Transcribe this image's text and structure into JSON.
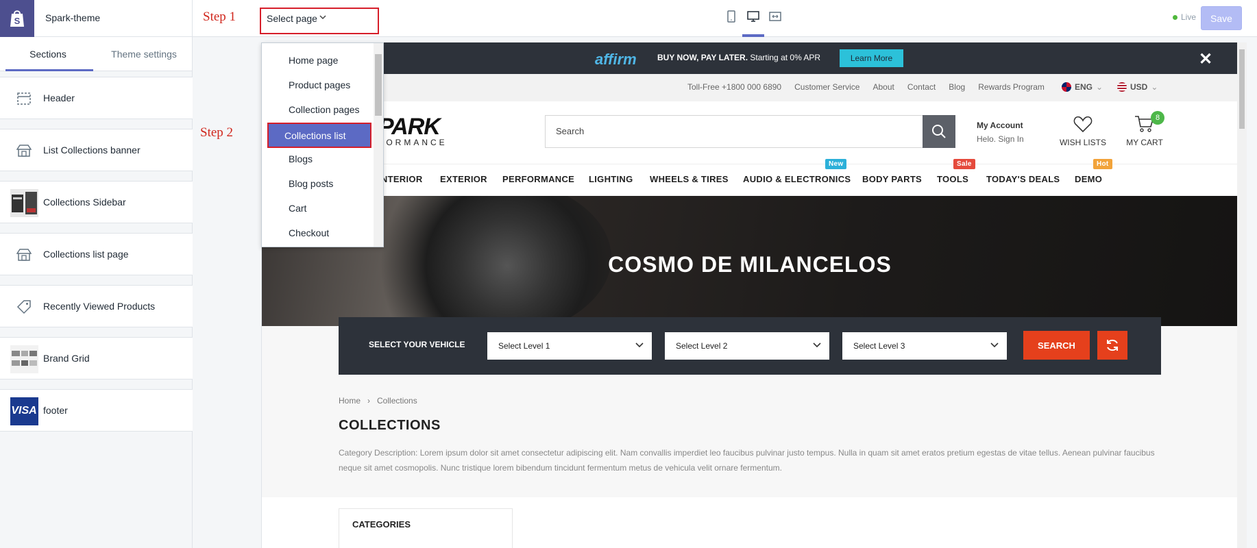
{
  "app": {
    "theme_name": "Spark-theme",
    "page_select_label": "Select page",
    "step1": "Step 1",
    "step2": "Step 2",
    "live_label": "Live",
    "save_label": "Save"
  },
  "sidebar": {
    "tabs": [
      {
        "label": "Sections",
        "active": true
      },
      {
        "label": "Theme settings",
        "active": false
      }
    ],
    "sections": [
      {
        "label": "Header",
        "icon": "header-layout-icon"
      },
      {
        "label": "List Collections banner",
        "icon": "store-icon"
      },
      {
        "label": "Collections Sidebar",
        "icon": "thumbnail-image"
      },
      {
        "label": "Collections list page",
        "icon": "store-icon"
      },
      {
        "label": "Recently Viewed Products",
        "icon": "tag-icon"
      },
      {
        "label": "Brand Grid",
        "icon": "brand-thumbnail"
      },
      {
        "label": "footer",
        "icon": "visa-logo"
      }
    ],
    "visa_text": "VISA"
  },
  "dropdown": {
    "items": [
      "Home page",
      "Product pages",
      "Collection pages",
      "Collections list",
      "Blogs",
      "Blog posts",
      "Cart",
      "Checkout"
    ],
    "selected": "Collections list"
  },
  "preview": {
    "affirm": {
      "logo": "affirm",
      "text_bold": "BUY NOW, PAY LATER.",
      "text": "Starting at 0% APR",
      "button": "Learn More"
    },
    "utility_links": [
      "Toll-Free +1800 000 6890",
      "Customer Service",
      "About",
      "Contact",
      "Blog",
      "Rewards Program"
    ],
    "language": "ENG",
    "currency": "USD",
    "brand": {
      "name": "PARK",
      "sub": "FORMANCE"
    },
    "search_placeholder": "Search",
    "account": {
      "title": "My Account",
      "sub": "Helo. Sign In"
    },
    "wishlist_label": "WISH LISTS",
    "cart_label": "MY CART",
    "cart_count": "8",
    "nav": [
      {
        "label": "INTERIOR",
        "badge": ""
      },
      {
        "label": "EXTERIOR",
        "badge": ""
      },
      {
        "label": "PERFORMANCE",
        "badge": ""
      },
      {
        "label": "LIGHTING",
        "badge": ""
      },
      {
        "label": "WHEELS & TIRES",
        "badge": ""
      },
      {
        "label": "AUDIO & ELECTRONICS",
        "badge": "New"
      },
      {
        "label": "BODY PARTS",
        "badge": ""
      },
      {
        "label": "TOOLS",
        "badge": "Sale"
      },
      {
        "label": "TODAY'S DEALS",
        "badge": ""
      },
      {
        "label": "DEMO",
        "badge": "Hot"
      }
    ],
    "hero_title": "COSMO DE MILANCELOS",
    "vehicle": {
      "label": "SELECT YOUR VEHICLE",
      "level1": "Select Level 1",
      "level2": "Select Level 2",
      "level3": "Select Level 3",
      "search": "SEARCH"
    },
    "breadcrumb": [
      "Home",
      "Collections"
    ],
    "collections_title": "COLLECTIONS",
    "description": "Category Description: Lorem ipsum dolor sit amet consectetur adipiscing elit. Nam convallis imperdiet leo faucibus pulvinar justo tempus. Nulla in quam sit amet eratos pretium egestas de vitae tellus. Aenean pulvinar faucibus neque sit amet cosmopolis. Nunc tristique lorem bibendum tincidunt fermentum metus de vehicula velit ornare fermentum.",
    "categories_title": "CATEGORIES"
  },
  "colors": {
    "accent": "#5c6ac4",
    "highlight": "#d61e2a",
    "search_button": "#e5401c",
    "badge_new": "#2cb0d9",
    "badge_sale": "#e54a3c",
    "badge_hot": "#f2a33a"
  }
}
